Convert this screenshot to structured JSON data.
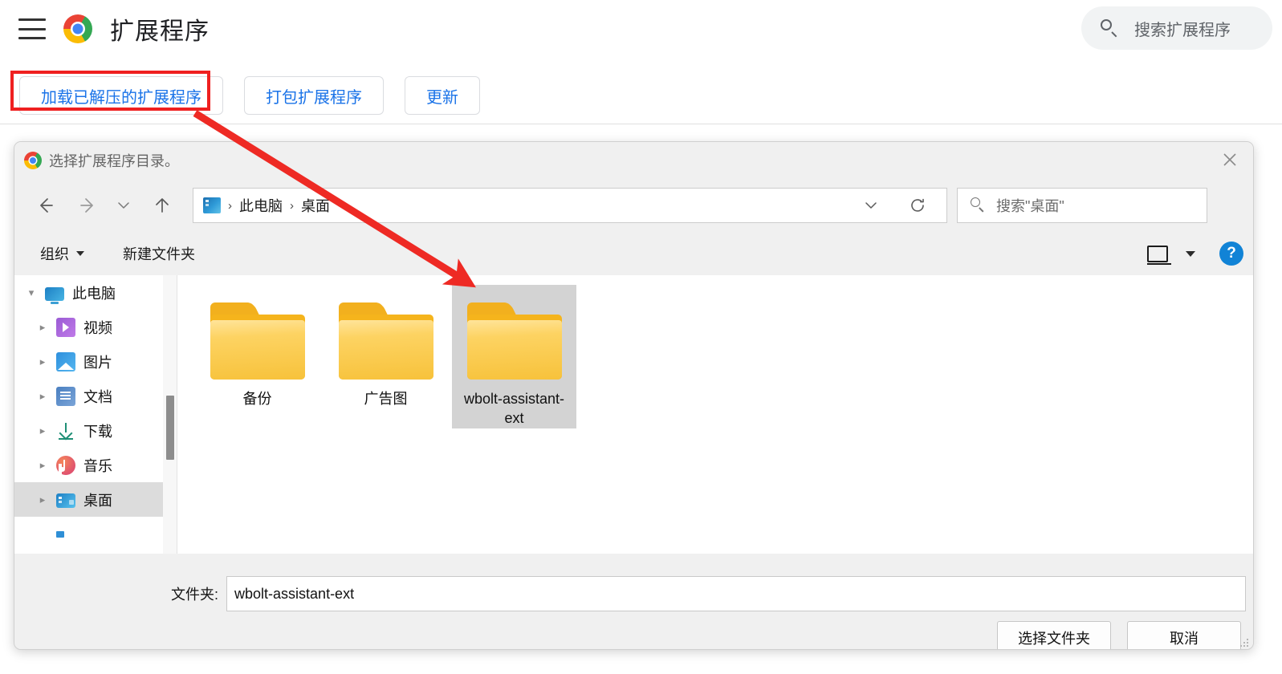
{
  "chrome_page": {
    "menu_icon": "hamburger-menu-icon",
    "logo_icon": "chrome-logo-icon",
    "title": "扩展程序",
    "search": {
      "icon": "search-icon",
      "placeholder": "搜索扩展程序",
      "value": ""
    },
    "toolbar": {
      "load_unpacked_label": "加载已解压的扩展程序",
      "pack_extension_label": "打包扩展程序",
      "update_label": "更新"
    },
    "annotations": {
      "highlight_color": "#ef2020",
      "arrow_color": "#ee2a24",
      "highlight_target": "加载已解压的扩展程序"
    }
  },
  "file_dialog": {
    "titlebar": {
      "icon": "chrome-logo-icon",
      "title": "选择扩展程序目录。",
      "close_label": "✕"
    },
    "nav": {
      "back_icon": "arrow-left-icon",
      "forward_icon": "arrow-right-icon",
      "recent_icon": "chevron-down-icon",
      "up_icon": "arrow-up-icon",
      "address": {
        "drive_icon": "desktop-drive-icon",
        "separator": "›",
        "crumbs": [
          "此电脑",
          "桌面"
        ],
        "chevron_icon": "chevron-down-icon",
        "refresh_icon": "refresh-icon"
      },
      "search": {
        "icon": "search-icon",
        "placeholder": "搜索\"桌面\"",
        "value": ""
      }
    },
    "commandbar": {
      "organize_label": "组织",
      "new_folder_label": "新建文件夹",
      "view_icon": "view-layout-icon",
      "view_caret_icon": "chevron-down-icon",
      "help_label": "?",
      "help_icon": "help-icon"
    },
    "sidebar": {
      "items": [
        {
          "label": "此电脑",
          "icon": "computer-icon",
          "level": "root",
          "expanded": true,
          "selected": false
        },
        {
          "label": "视频",
          "icon": "videos-icon",
          "level": "child",
          "expanded": false,
          "selected": false
        },
        {
          "label": "图片",
          "icon": "pictures-icon",
          "level": "child",
          "expanded": false,
          "selected": false
        },
        {
          "label": "文档",
          "icon": "documents-icon",
          "level": "child",
          "expanded": false,
          "selected": false
        },
        {
          "label": "下载",
          "icon": "downloads-icon",
          "level": "child",
          "expanded": false,
          "selected": false
        },
        {
          "label": "音乐",
          "icon": "music-icon",
          "level": "child",
          "expanded": false,
          "selected": false
        },
        {
          "label": "桌面",
          "icon": "desktop-icon",
          "level": "child",
          "expanded": false,
          "selected": true
        }
      ],
      "scrollbar": {
        "icon": "scrollbar-thumb"
      }
    },
    "filelist": {
      "items": [
        {
          "name": "备份",
          "icon": "folder-icon",
          "selected": false
        },
        {
          "name": "广告图",
          "icon": "folder-icon",
          "selected": false
        },
        {
          "name": "wbolt-assistant-ext",
          "icon": "folder-icon",
          "selected": true
        }
      ]
    },
    "footer": {
      "folder_label": "文件夹:",
      "folder_value": "wbolt-assistant-ext",
      "select_folder_label": "选择文件夹",
      "cancel_label": "取消"
    }
  }
}
